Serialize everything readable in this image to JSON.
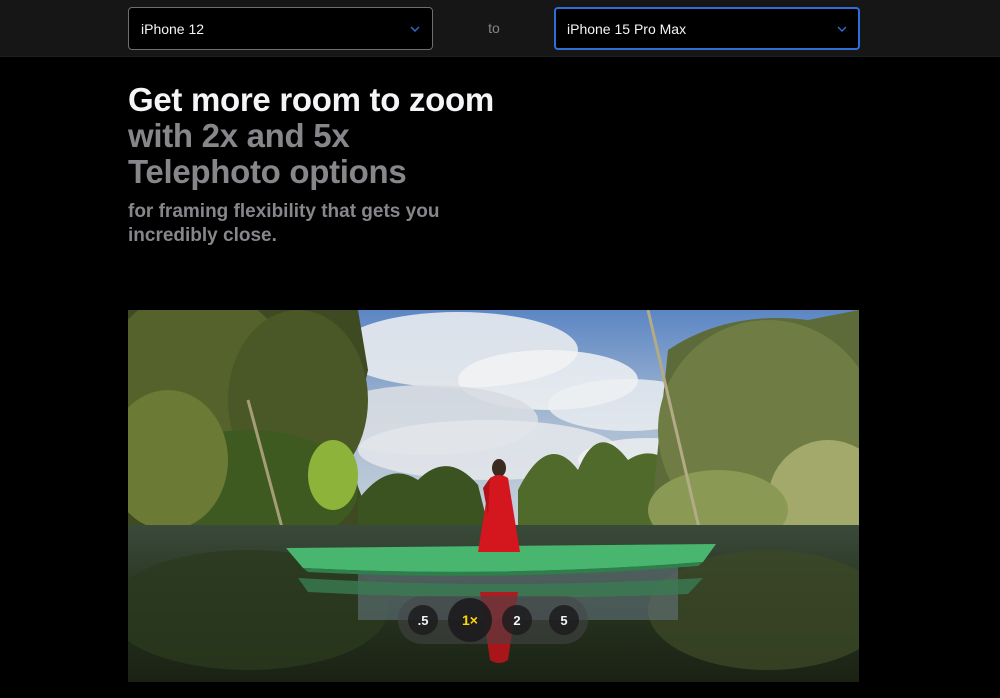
{
  "compare": {
    "left_device": "iPhone 12",
    "connector": "to",
    "right_device": "iPhone 15 Pro Max"
  },
  "headline": {
    "line1": "Get more room to zoom",
    "line2": "with 2x and 5x",
    "line3": "Telephoto options"
  },
  "subhead": "for framing flexibility that gets you incredibly close.",
  "zoom": {
    "options": [
      ".5",
      "1×",
      "2",
      "5"
    ],
    "selected": "1×"
  },
  "colors": {
    "accent_blue": "#2d6fd6",
    "zoom_active": "#ffd60a",
    "text_primary": "#f5f5f7",
    "text_secondary": "#86868b"
  },
  "icons": {
    "dropdown": "chevron-down-icon"
  }
}
